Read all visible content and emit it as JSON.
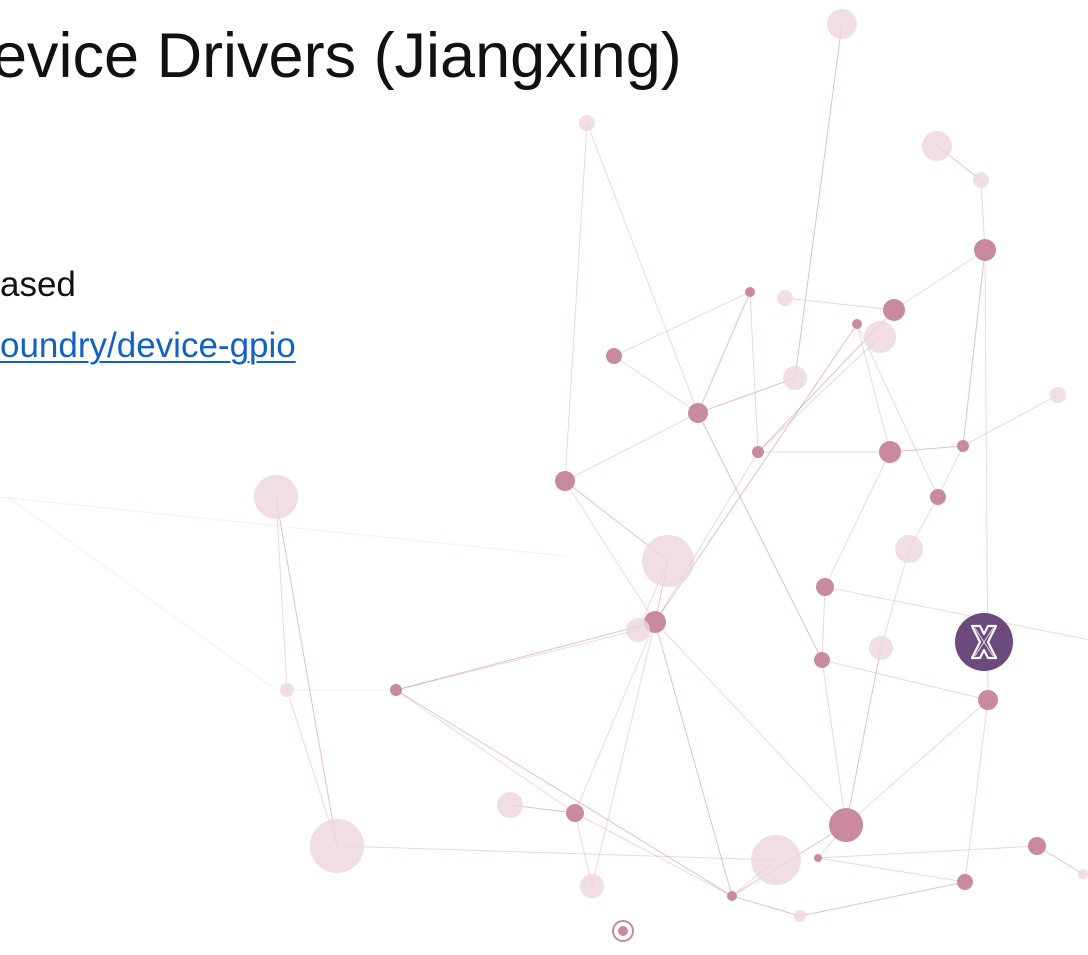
{
  "slide": {
    "title": "evice Drivers (Jiangxing)",
    "line1": "ased",
    "link_text": "oundry/device-gpio"
  },
  "badge": {
    "icon": "x-logo-icon",
    "color": "#6d4a7d"
  },
  "colors": {
    "text": "#111111",
    "link": "#1261c7",
    "node": "#c98a9f",
    "node_light": "#ecd6dd",
    "edge": "#cc8ea2"
  }
}
